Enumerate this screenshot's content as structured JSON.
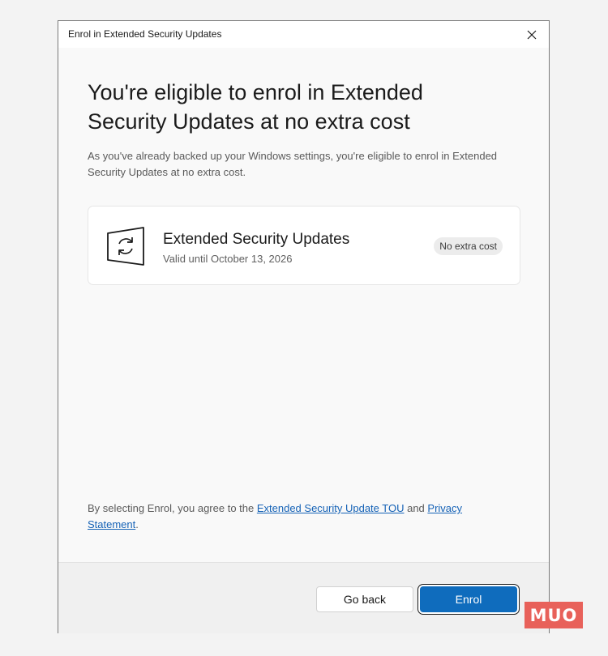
{
  "window": {
    "title": "Enrol in Extended Security Updates",
    "close_icon": "close-icon"
  },
  "main": {
    "heading": "You're eligible to enrol in Extended Security Updates at no extra cost",
    "description": "As you've already backed up your Windows settings, you're eligible to enrol in Extended Security Updates at no extra cost."
  },
  "card": {
    "icon": "windows-update-sync-icon",
    "title": "Extended Security Updates",
    "subtitle": "Valid until October 13, 2026",
    "badge": "No extra cost"
  },
  "legal": {
    "prefix": "By selecting Enrol, you agree to the ",
    "tou_link": "Extended Security Update TOU",
    "middle": " and ",
    "privacy_link": "Privacy Statement",
    "suffix": "."
  },
  "footer": {
    "go_back_label": "Go back",
    "enrol_label": "Enrol"
  },
  "watermark": {
    "text": "MUO"
  },
  "colors": {
    "accent": "#0f6cbd",
    "link": "#1562b6",
    "watermark": "#e8615a"
  }
}
